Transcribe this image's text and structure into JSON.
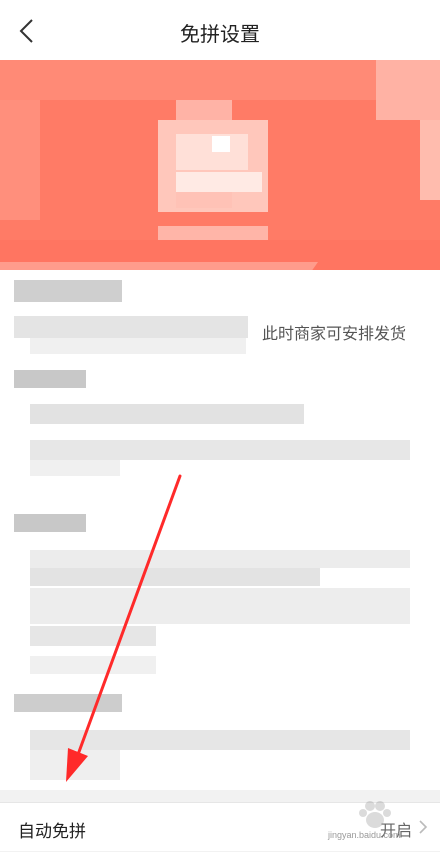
{
  "nav": {
    "title": "免拼设置"
  },
  "content": {
    "visible_hint": "此时商家可安排发货"
  },
  "setting_row": {
    "label": "自动免拼",
    "value": "开启"
  },
  "watermark": {
    "text": "jingyan.baidu.com"
  },
  "colors": {
    "banner": "#ff7b66",
    "arrow": "#ff2a2a"
  },
  "icons": {
    "back": "chevron-left-icon",
    "row": "chevron-right-icon"
  }
}
